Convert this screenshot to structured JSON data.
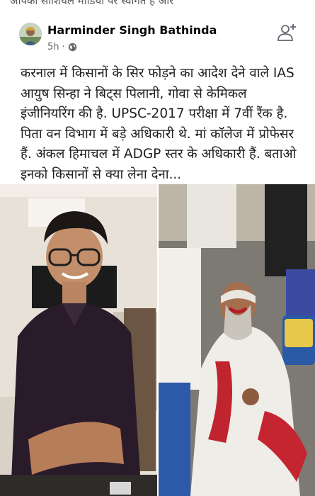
{
  "top_strip": {
    "text": "आपका सोशियल मीडिया पर स्वागत है ओर"
  },
  "post": {
    "author": "Harminder Singh Bathinda",
    "time": "5h",
    "privacy_icon": "globe-icon",
    "follow_icon": "add-friend-icon",
    "text": "करनाल में किसानों के सिर फोड़ने का आदेश देने वाले IAS आयुष सिन्हा ने बिट्स पिलानी, गोवा से केमिकल इंजीनियरिंग की है. UPSC-2017 परीक्षा में 7वीं रैंक है. पिता वन विभाग में बड़े अधिकारी थे. मां कॉलेज में प्रोफेसर हैं. अंकल हिमाचल में ADGP स्तर के अधिकारी हैं. बताओ इनको किसानों से क्या लेना देना..."
  },
  "photos": [
    {
      "alt": "smiling young man with glasses in a dark polo shirt"
    },
    {
      "alt": "injured elderly farmer with bandaged bleeding head sitting among people"
    }
  ],
  "colors": {
    "text": "#1c1e21",
    "meta": "#65676b",
    "accent": "#d21f2a"
  }
}
